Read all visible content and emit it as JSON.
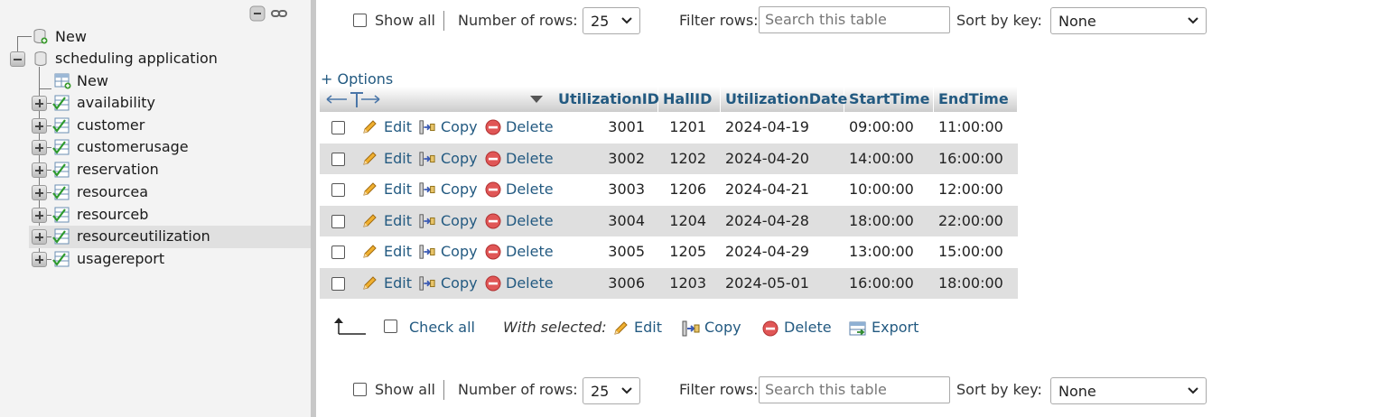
{
  "navigation": {
    "new_label": "New",
    "database": {
      "name": "scheduling application",
      "new_label": "New",
      "tables": [
        "availability",
        "customer",
        "customerusage",
        "reservation",
        "resourcea",
        "resourceb",
        "resourceutilization",
        "usagereport"
      ],
      "selected": "resourceutilization"
    }
  },
  "top_controls": {
    "show_all": "Show all",
    "rows_label": "Number of rows:",
    "rows_value": "25",
    "filter_label": "Filter rows:",
    "filter_placeholder": "Search this table",
    "sort_label": "Sort by key:",
    "sort_value": "None"
  },
  "options_link": "+ Options",
  "table": {
    "columns": [
      "UtilizationID",
      "HallID",
      "UtilizationDate",
      "StartTime",
      "EndTime"
    ],
    "actions": {
      "edit": "Edit",
      "copy": "Copy",
      "delete": "Delete"
    },
    "rows": [
      [
        "3001",
        "1201",
        "2024-04-19",
        "09:00:00",
        "11:00:00"
      ],
      [
        "3002",
        "1202",
        "2024-04-20",
        "14:00:00",
        "16:00:00"
      ],
      [
        "3003",
        "1206",
        "2024-04-21",
        "10:00:00",
        "12:00:00"
      ],
      [
        "3004",
        "1204",
        "2024-04-28",
        "18:00:00",
        "22:00:00"
      ],
      [
        "3005",
        "1205",
        "2024-04-29",
        "13:00:00",
        "15:00:00"
      ],
      [
        "3006",
        "1203",
        "2024-05-01",
        "16:00:00",
        "18:00:00"
      ]
    ]
  },
  "bulk": {
    "check_all": "Check all",
    "with_selected": "With selected:",
    "edit": "Edit",
    "copy": "Copy",
    "delete": "Delete",
    "export": "Export"
  },
  "bottom_controls": {
    "show_all": "Show all",
    "rows_label": "Number of rows:",
    "rows_value": "25",
    "filter_label": "Filter rows:",
    "filter_placeholder": "Search this table",
    "sort_label": "Sort by key:",
    "sort_value": "None"
  },
  "colors": {
    "link": "#235a81",
    "row_alt": "#dfdfdf",
    "sidebar_bg": "#f3f3f3",
    "selected_bg": "#e0e0e0"
  }
}
